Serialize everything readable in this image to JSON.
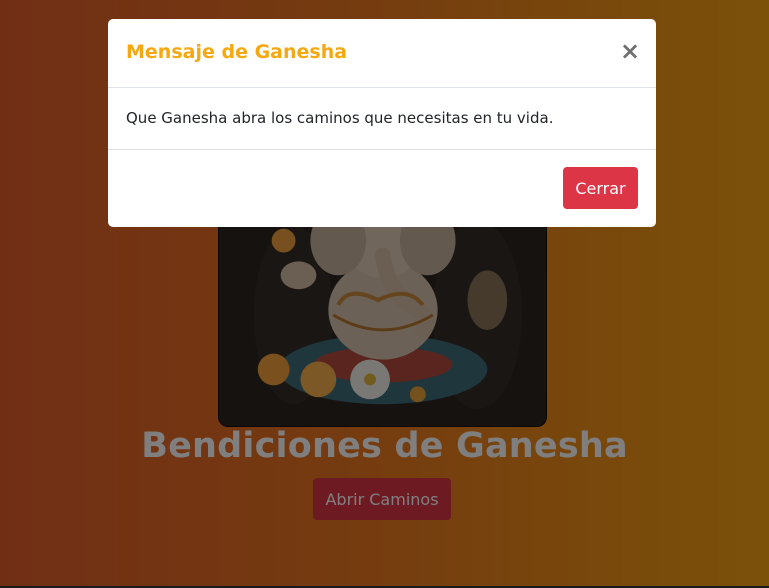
{
  "main": {
    "title": "Bendiciones de Ganesha",
    "button_label": "Abrir Caminos"
  },
  "modal": {
    "title": "Mensaje de Ganesha",
    "close_symbol": "×",
    "message": "Que Ganesha abra los caminos que necesitas en tu vida.",
    "close_button_label": "Cerrar"
  },
  "colors": {
    "modal_title": "#f5a810",
    "danger_button": "#dc3545",
    "background_start": "#e35d2b",
    "background_end": "#f6a313"
  },
  "image": {
    "subject": "ganesha-statue-with-flowers"
  }
}
